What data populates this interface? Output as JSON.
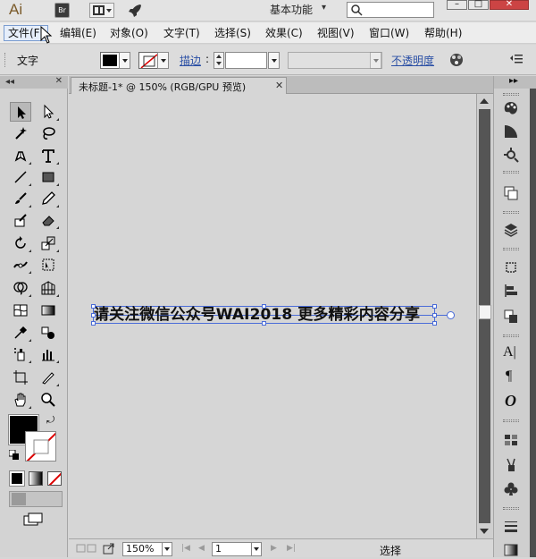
{
  "titlebar": {
    "app_logo": "Ai",
    "bridge_label": "Br",
    "workspace_label": "基本功能",
    "workspace_caret": "▾",
    "search_placeholder": "",
    "win_min": "–",
    "win_max": "□",
    "win_close": "✕",
    "icons": [
      "arrange-documents-icon",
      "gpu-rocket-icon",
      "search-icon"
    ]
  },
  "menubar": {
    "items": [
      {
        "label": "文件(F)"
      },
      {
        "label": "编辑(E)"
      },
      {
        "label": "对象(O)"
      },
      {
        "label": "文字(T)"
      },
      {
        "label": "选择(S)"
      },
      {
        "label": "效果(C)"
      },
      {
        "label": "视图(V)"
      },
      {
        "label": "窗口(W)"
      },
      {
        "label": "帮助(H)"
      }
    ]
  },
  "control": {
    "type_label": "文字",
    "fill_color": "#000000",
    "stroke_label": "描边",
    "stroke_colon": ":",
    "stroke_value": "",
    "opacity_label": "不透明度"
  },
  "document": {
    "tab_title": "未标题-1* @ 150% (RGB/GPU 预览)",
    "tab_close": "✕",
    "art_text": "请关注微信公众号WAI2018 更多精彩内容分享"
  },
  "status": {
    "zoom": "150%",
    "page": "1",
    "nav_first": "|◀",
    "nav_prev": "◀",
    "nav_next": "▶",
    "nav_last": "▶|",
    "tool_status": "选择"
  },
  "toolbox": {
    "header_arrows": "◂◂",
    "header_close": "✕",
    "swap_glyph": "⤾"
  },
  "rightdock": {
    "header_arrows": "▸▸",
    "type_glyph": "A|",
    "paragraph_glyph": "¶",
    "opentype_glyph": "O"
  },
  "colors": {
    "selection": "#4a6cd8",
    "menu_highlight": "#e6eefa",
    "link_blue": "#2a4fa5"
  }
}
